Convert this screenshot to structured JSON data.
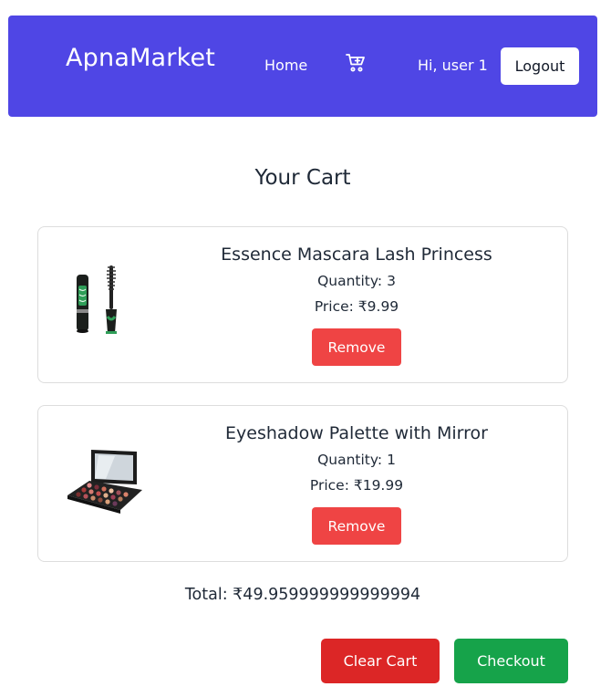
{
  "header": {
    "brand": "ApnaMarket",
    "nav_home": "Home",
    "cart_icon": "cart-plus-icon",
    "greeting": "Hi, user 1",
    "logout_label": "Logout",
    "background_color": "#4f46e5"
  },
  "cart": {
    "title": "Your Cart",
    "items": [
      {
        "name": "Essence Mascara Lash Princess",
        "quantity_text": "Quantity: 3",
        "price_text": "Price: ₹9.99",
        "remove_label": "Remove",
        "image": "mascara-product-image"
      },
      {
        "name": "Eyeshadow Palette with Mirror",
        "quantity_text": "Quantity: 1",
        "price_text": "Price: ₹19.99",
        "remove_label": "Remove",
        "image": "eyeshadow-palette-product-image"
      }
    ],
    "total_text": "Total: ₹49.959999999999994",
    "clear_label": "Clear Cart",
    "checkout_label": "Checkout"
  },
  "colors": {
    "remove": "#ef4444",
    "clear": "#dc2626",
    "checkout": "#16a34a"
  }
}
